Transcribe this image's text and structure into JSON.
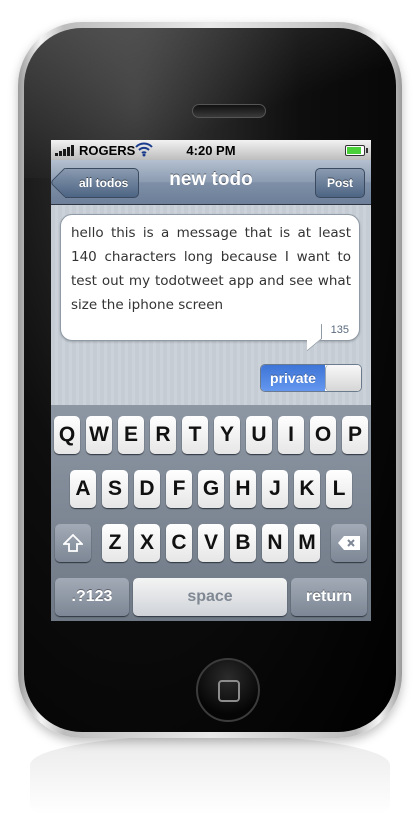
{
  "status_bar": {
    "carrier": "ROGERS",
    "time": "4:20 PM"
  },
  "nav": {
    "back_label": "all todos",
    "title": "new todo",
    "post_label": "Post"
  },
  "compose": {
    "message": "hello this is a message that is at least 140 characters long because I want to test out my todotweet app and see what size the iphone screen",
    "char_count": "135"
  },
  "private_toggle": {
    "label": "private",
    "on": true
  },
  "keyboard": {
    "row1": [
      "Q",
      "W",
      "E",
      "R",
      "T",
      "Y",
      "U",
      "I",
      "O",
      "P"
    ],
    "row2": [
      "A",
      "S",
      "D",
      "F",
      "G",
      "H",
      "J",
      "K",
      "L"
    ],
    "row3": [
      "Z",
      "X",
      "C",
      "V",
      "B",
      "N",
      "M"
    ],
    "numbers_label": ".?123",
    "space_label": "space",
    "return_label": "return",
    "shift_icon": "shift-arrow-icon",
    "backspace_icon": "backspace-icon"
  },
  "colors": {
    "nav_bar": "#6d7f99",
    "toggle_on": "#3e74d6"
  }
}
